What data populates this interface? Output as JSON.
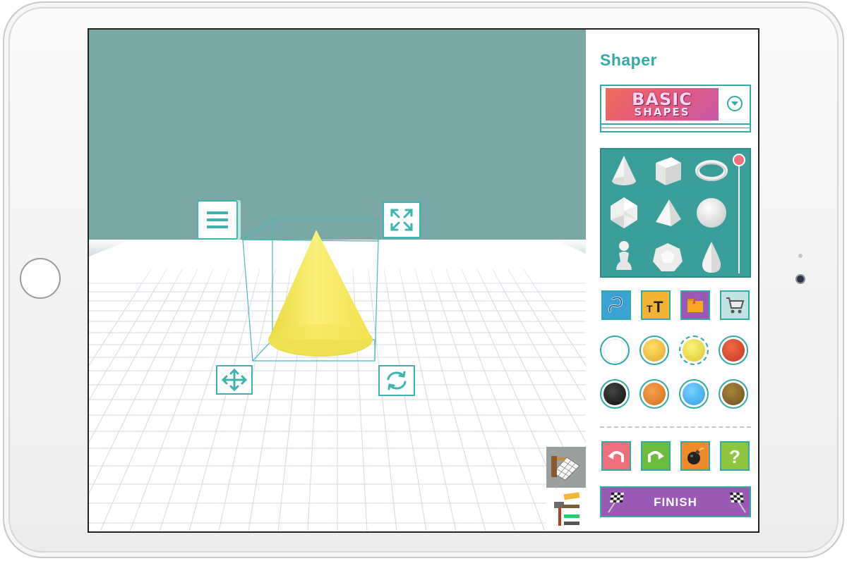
{
  "app": {
    "title": "Shaper",
    "category": {
      "line1": "BASIC",
      "line2": "SHAPES"
    },
    "shape_library": [
      "cone",
      "cube",
      "torus",
      "icosahedron",
      "tetrahedron",
      "sphere",
      "pawn",
      "dodecahedron",
      "teardrop"
    ],
    "tools": [
      {
        "name": "freeform-curve",
        "color": "#3aa3d6"
      },
      {
        "name": "text",
        "color": "#f2b233"
      },
      {
        "name": "folder",
        "color": "#9b59b6"
      },
      {
        "name": "shopping-cart",
        "color": "#bfe3e2"
      }
    ],
    "colors": [
      "#ffffff",
      "#f2c12e",
      "#f0e24a",
      "#e0452b",
      "#222222",
      "#f0892a",
      "#4db8f0",
      "#8b6a28"
    ],
    "actions": [
      {
        "name": "undo",
        "color": "#ef6f7d"
      },
      {
        "name": "redo",
        "color": "#6dbb3c"
      },
      {
        "name": "bomb",
        "color": "#f0892a"
      },
      {
        "name": "help",
        "color": "#8dc63f"
      }
    ],
    "finish_label": "FINISH"
  },
  "scene": {
    "selected_object": "cone",
    "object_color": "#f8ee6a",
    "wall_color": "#7aa8a6",
    "floor_color": "#ffffff"
  }
}
